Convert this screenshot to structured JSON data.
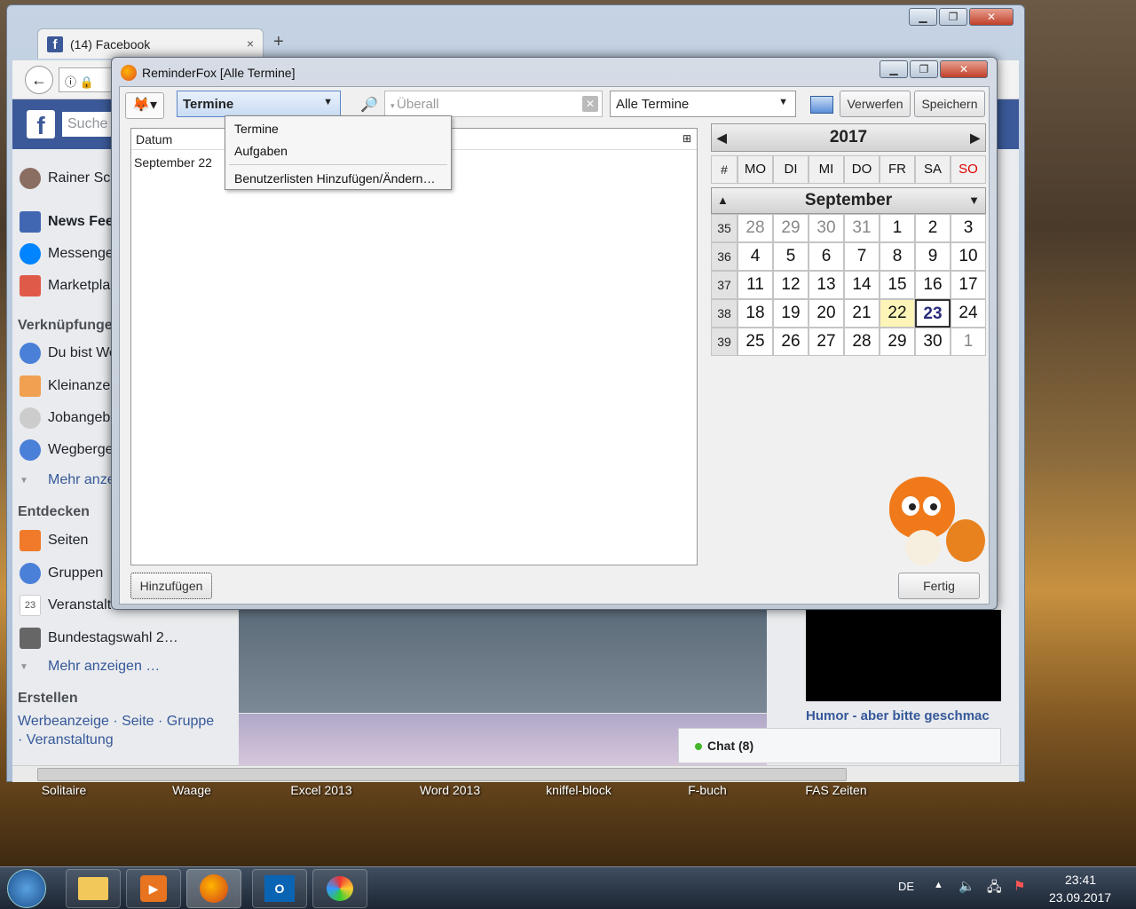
{
  "desktop_labels": [
    "Solitaire",
    "Waage",
    "Excel 2013",
    "Word 2013",
    "kniffel-block",
    "F-buch",
    "FAS Zeiten"
  ],
  "browser": {
    "tab_title": "(14) Facebook",
    "new_tab": "+",
    "close_tab": "×",
    "search_placeholder": "Suche",
    "profile_name": "Rainer Sch",
    "nav": [
      "News Feed",
      "Messenger",
      "Marketplace"
    ],
    "shortcuts_head": "Verknüpfungen",
    "shortcuts": [
      "Du bist We",
      "Kleinanzeig",
      "Jobangebo",
      "Wegberger"
    ],
    "more1": "Mehr anzei",
    "discover_head": "Entdecken",
    "discover": [
      "Seiten",
      "Gruppen",
      "Veranstaltu",
      "Bundestagswahl 2…"
    ],
    "more2": "Mehr anzeigen …",
    "create_head": "Erstellen",
    "create_links": "Werbeanzeige · Seite · Gruppe",
    "create_links2": "· Veranstaltung",
    "cal_badge": "23",
    "right_title": "Humor - aber bitte geschmac",
    "chat": "Chat (8)"
  },
  "reminderfox": {
    "title": "ReminderFox [Alle Termine]",
    "list_select": "Termine",
    "search_placeholder": "Überall",
    "filter_select": "Alle Termine",
    "btn_discard": "Verwerfen",
    "btn_save": "Speichern",
    "column_date": "Datum",
    "rows": [
      "September 22"
    ],
    "btn_add": "Hinzufügen",
    "btn_done": "Fertig",
    "popup": [
      "Termine",
      "Aufgaben",
      "Benutzerlisten Hinzufügen/Ändern…"
    ],
    "year": "2017",
    "month": "September",
    "weekday_hash": "#",
    "weekdays": [
      "MO",
      "DI",
      "MI",
      "DO",
      "FR",
      "SA",
      "SO"
    ],
    "weeks": [
      {
        "wk": "35",
        "days": [
          "28",
          "29",
          "30",
          "31",
          "1",
          "2",
          "3"
        ]
      },
      {
        "wk": "36",
        "days": [
          "4",
          "5",
          "6",
          "7",
          "8",
          "9",
          "10"
        ]
      },
      {
        "wk": "37",
        "days": [
          "11",
          "12",
          "13",
          "14",
          "15",
          "16",
          "17"
        ]
      },
      {
        "wk": "38",
        "days": [
          "18",
          "19",
          "20",
          "21",
          "22",
          "23",
          "24"
        ]
      },
      {
        "wk": "39",
        "days": [
          "25",
          "26",
          "27",
          "28",
          "29",
          "30",
          "1"
        ]
      }
    ]
  },
  "taskbar": {
    "lang": "DE",
    "time": "23:41",
    "date": "23.09.2017"
  }
}
